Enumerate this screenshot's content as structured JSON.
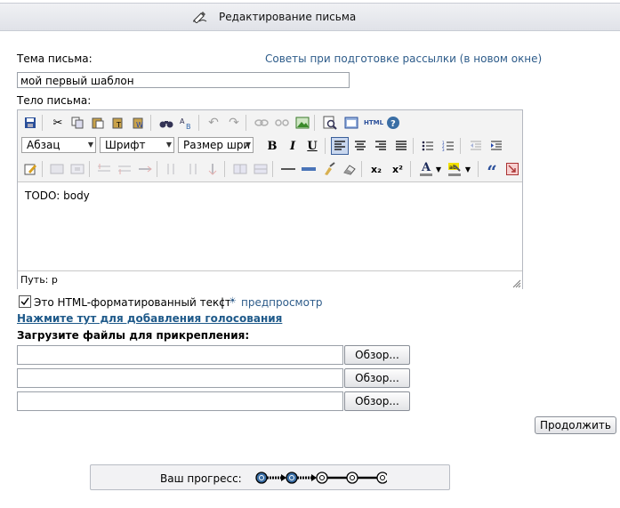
{
  "header": {
    "title": "Редактирование письма",
    "icon": "pen-icon"
  },
  "subject": {
    "label": "Тема письма:",
    "value": "мой первый шаблон"
  },
  "tips_link": "Советы при подготовке рассылки (в новом окне)",
  "body": {
    "label": "Тело письма:"
  },
  "editor": {
    "format_select": "Абзац",
    "font_select": "Шрифт",
    "size_select": "Размер шри",
    "content": "TODO: body",
    "path_label": "Путь: p",
    "html_button_label": "HTML",
    "bold_label": "B",
    "italic_label": "I",
    "underline_label": "U",
    "subscript_label": "x₂",
    "superscript_label": "x²",
    "font_color_label": "A",
    "quote_label": "“"
  },
  "html_checkbox": {
    "checked": true,
    "label": "Это HTML-форматированный текст",
    "separator": "|",
    "preview_label": "предпросмотр"
  },
  "poll_link": "Нажмите тут для добавления голосования",
  "attachments": {
    "label": "Загрузите файлы для прикрепления:",
    "browse_labels": [
      "Обзор...",
      "Обзор...",
      "Обзор..."
    ]
  },
  "continue_label": "Продолжить",
  "progress": {
    "label": "Ваш прогресс:",
    "steps_total": 5,
    "steps_done": 2
  },
  "colors": {
    "link": "#2e5c8a",
    "accent": "#3a6ea5",
    "header_bg": "#e6e8ec"
  }
}
